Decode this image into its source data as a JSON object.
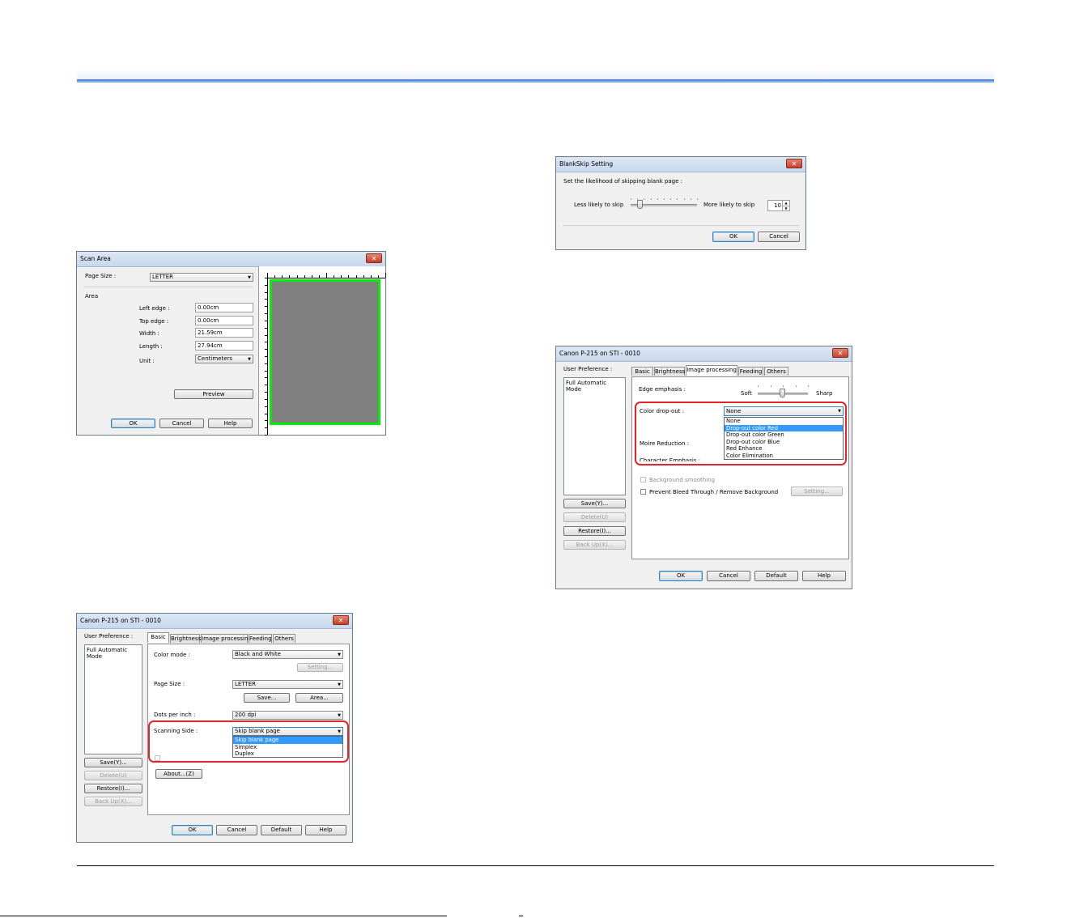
{
  "scan_area": {
    "title": "Scan Area",
    "page_size_label": "Page Size :",
    "page_size_value": "LETTER",
    "area_label": "Area",
    "left_edge_label": "Left edge :",
    "left_edge_value": "0.00cm",
    "top_edge_label": "Top edge :",
    "top_edge_value": "0.00cm",
    "width_label": "Width :",
    "width_value": "21.59cm",
    "length_label": "Length :",
    "length_value": "27.94cm",
    "unit_label": "Unit :",
    "unit_value": "Centimeters",
    "preview_label": "Preview",
    "ok_label": "OK",
    "cancel_label": "Cancel",
    "help_label": "Help",
    "preview_color": "#808080",
    "frame_color": "#00ee00"
  },
  "blankskip": {
    "title": "BlankSkip Setting",
    "prompt": "Set the likelihood of skipping blank page :",
    "less_label": "Less likely to skip",
    "more_label": "More likely to skip",
    "value": "10",
    "ok_label": "OK",
    "cancel_label": "Cancel"
  },
  "main_basic": {
    "title": "Canon P-215 on STI - 0010",
    "user_pref_label": "User Preference :",
    "list_item": "Full Automatic Mode",
    "tabs": [
      "Basic",
      "Brightness",
      "Image processing",
      "Feeding",
      "Others"
    ],
    "color_mode_label": "Color mode :",
    "color_mode_value": "Black and White",
    "setting_label": "Setting...",
    "page_size_label": "Page Size :",
    "page_size_value": "LETTER",
    "save_btn": "Save...",
    "area_btn": "Area...",
    "dpi_label": "Dots per inch :",
    "dpi_value": "200 dpi",
    "scanning_side_label": "Scanning Side :",
    "scanning_side_value": "Skip blank page",
    "scanning_side_options": [
      "Skip blank page",
      "Simplex",
      "Duplex"
    ],
    "about_btn": "About...(Z)",
    "save_pref": "Save(Y)...",
    "delete_pref": "Delete(U)",
    "restore_pref": "Restore(I)...",
    "backup_pref": "Back Up(X)...",
    "ok_label": "OK",
    "cancel_label": "Cancel",
    "default_label": "Default",
    "help_label": "Help"
  },
  "main_imgproc": {
    "title": "Canon P-215 on STI - 0010",
    "user_pref_label": "User Preference :",
    "list_item": "Full Automatic Mode",
    "tabs": [
      "Basic",
      "Brightness",
      "Image processing",
      "Feeding",
      "Others"
    ],
    "edge_label": "Edge emphasis :",
    "soft_label": "Soft",
    "sharp_label": "Sharp",
    "color_dropout_label": "Color drop-out :",
    "color_dropout_value": "None",
    "color_dropout_options": [
      "None",
      "Drop-out color Red",
      "Drop-out color Green",
      "Drop-out color Blue",
      "Red Enhance",
      "Color Elimination"
    ],
    "moire_label": "Moire Reduction :",
    "char_label": "Character Emphasis :",
    "bg_smoothing_label": "Background smoothing",
    "bleed_label": "Prevent Bleed Through / Remove Background",
    "setting_label": "Setting...",
    "save_pref": "Save(Y)...",
    "delete_pref": "Delete(U)",
    "restore_pref": "Restore(I)...",
    "backup_pref": "Back Up(X)...",
    "ok_label": "OK",
    "cancel_label": "Cancel",
    "default_label": "Default",
    "help_label": "Help"
  },
  "colors": {
    "highlight": "#e0262b",
    "selection": "#3399ff",
    "header_rule": "#3a78c8"
  }
}
